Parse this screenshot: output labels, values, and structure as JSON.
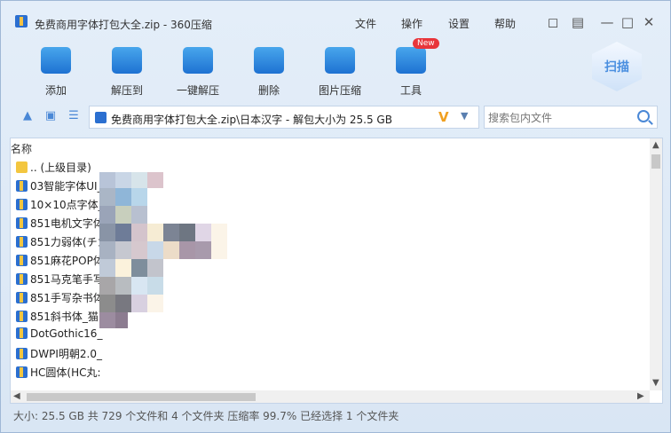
{
  "title": "免费商用字体打包大全.zip - 360压缩",
  "menu": [
    "文件",
    "操作",
    "设置",
    "帮助"
  ],
  "toolbar": [
    {
      "label": "添加",
      "icon": "add-icon"
    },
    {
      "label": "解压到",
      "icon": "extract-to-icon"
    },
    {
      "label": "一键解压",
      "icon": "one-click-extract-icon"
    },
    {
      "label": "删除",
      "icon": "trash-icon"
    },
    {
      "label": "图片压缩",
      "icon": "image-compress-icon"
    },
    {
      "label": "工具",
      "icon": "tools-icon"
    }
  ],
  "new_badge": "New",
  "scan_label": "扫描",
  "address": "免费商用字体打包大全.zip\\日本汉字 - 解包大小为 25.5 GB",
  "search_placeholder": "搜索包内文件",
  "column_name": "名称",
  "files": [
    ".. (上级目录)",
    "03智能字体UI_",
    "10×10点字体_",
    "851电机文字体",
    "851力弱体(チカ",
    "851麻花POP体",
    "851马克笔手写",
    "851手写杂书体",
    "851斜书体_猫",
    "DotGothic16_",
    "DWPI明朝2.0_",
    "HC圆体(HC丸:"
  ],
  "status": "大小: 25.5 GB 共 729 个文件和 4 个文件夹 压缩率 99.7% 已经选择 1 个文件夹",
  "colors": {
    "accent": "#1e72d2",
    "folder": "#f3c63f",
    "new": "#e8353a"
  }
}
